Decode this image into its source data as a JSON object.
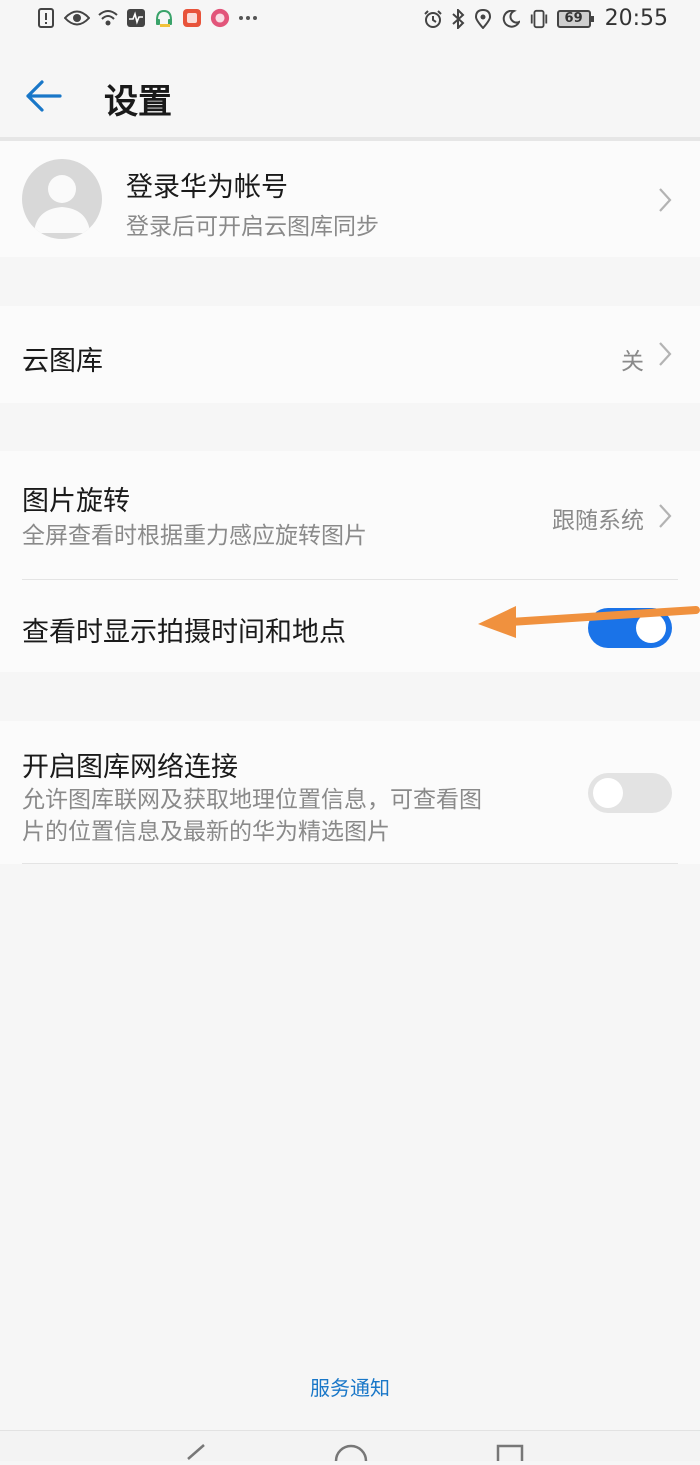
{
  "status_bar": {
    "left_icons": [
      "alert-icon",
      "eye-icon",
      "wifi-icon",
      "activity-icon",
      "headset-icon",
      "app-badge-icon",
      "app-circle-icon",
      "more-dots-icon"
    ],
    "right_icons": [
      "alarm-icon",
      "bluetooth-icon",
      "location-icon",
      "moon-icon",
      "vibrate-icon"
    ],
    "battery": "69",
    "time": "20:55"
  },
  "header": {
    "title": "设置"
  },
  "account": {
    "title": "登录华为帐号",
    "subtitle": "登录后可开启云图库同步"
  },
  "cloud_gallery": {
    "title": "云图库",
    "value": "关"
  },
  "photo_rotate": {
    "title": "图片旋转",
    "subtitle": "全屏查看时根据重力感应旋转图片",
    "value": "跟随系统"
  },
  "show_time_location": {
    "title": "查看时显示拍摄时间和地点",
    "enabled": true
  },
  "network": {
    "title": "开启图库网络连接",
    "subtitle_line1": "允许图库联网及获取地理位置信息，可查看图",
    "subtitle_line2": "片的位置信息及最新的华为精选图片",
    "enabled": false
  },
  "footer": {
    "service_link": "服务通知"
  },
  "colors": {
    "accent": "#1a73e8",
    "arrow": "#f0913e",
    "link": "#1977c8"
  }
}
